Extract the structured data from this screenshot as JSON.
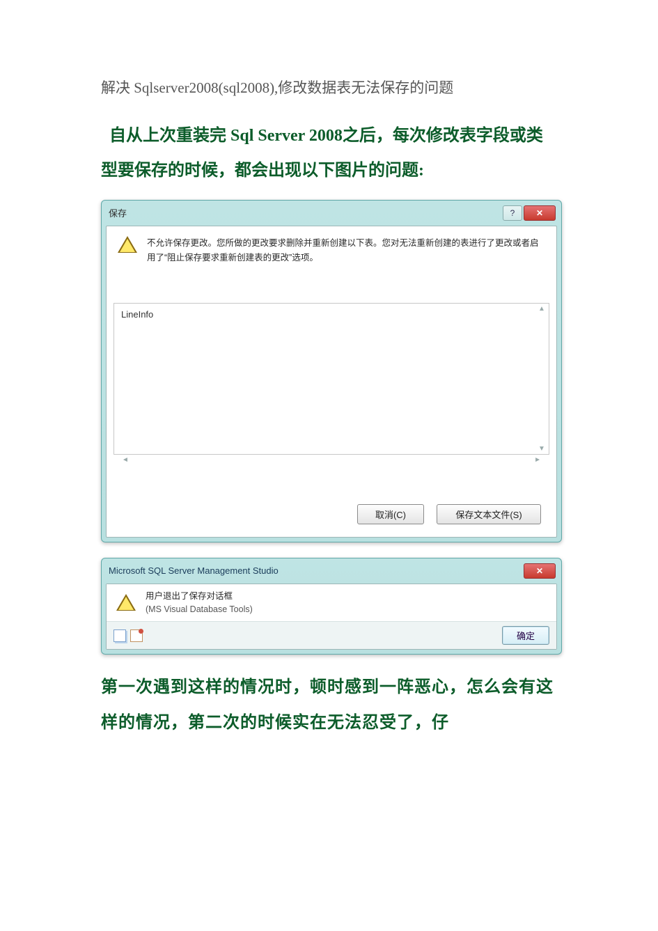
{
  "doc": {
    "title": "解决 Sqlserver2008(sql2008),修改数据表无法保存的问题",
    "intro": "自从上次重装完 Sql Server 2008之后，每次修改表字段或类型要保存的时候，都会出现以下图片的问题:",
    "outro": "第一次遇到这样的情况时，顿时感到一阵恶心，怎么会有这样的情况，第二次的时候实在无法忍受了，仔"
  },
  "dialog1": {
    "title": "保存",
    "help_symbol": "?",
    "close_symbol": "✕",
    "bang": "!",
    "message": "不允许保存更改。您所做的更改要求删除并重新创建以下表。您对无法重新创建的表进行了更改或者启用了“阻止保存要求重新创建表的更改”选项。",
    "list_item": "LineInfo",
    "scroll_up": "▲",
    "scroll_down": "▼",
    "scroll_left": "◄",
    "scroll_right": "►",
    "cancel": "取消(C)",
    "save_text": "保存文本文件(S)"
  },
  "dialog2": {
    "title": "Microsoft SQL Server Management Studio",
    "close_symbol": "✕",
    "bang": "!",
    "line1": "用户退出了保存对话框",
    "line2": "(MS Visual Database Tools)",
    "ok": "确定"
  }
}
